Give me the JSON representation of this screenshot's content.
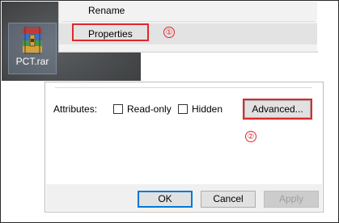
{
  "desktop": {
    "file": {
      "name": "PCT.rar",
      "icon": "winrar-archive-icon"
    }
  },
  "context_menu": {
    "items": [
      {
        "label": "Rename"
      },
      {
        "label": "Properties",
        "highlighted": true
      }
    ]
  },
  "steps": {
    "step1": "①",
    "step2": "②"
  },
  "properties_dialog": {
    "attributes_label": "Attributes:",
    "checkboxes": [
      {
        "label": "Read-only",
        "checked": false
      },
      {
        "label": "Hidden",
        "checked": false
      }
    ],
    "advanced_label": "Advanced...",
    "buttons": {
      "ok": "OK",
      "cancel": "Cancel",
      "apply": "Apply"
    }
  },
  "colors": {
    "annotation_red": "#e0272c",
    "focus_blue": "#0078d7",
    "menu_background": "#f2f2f2",
    "desktop_background": "#505356"
  }
}
